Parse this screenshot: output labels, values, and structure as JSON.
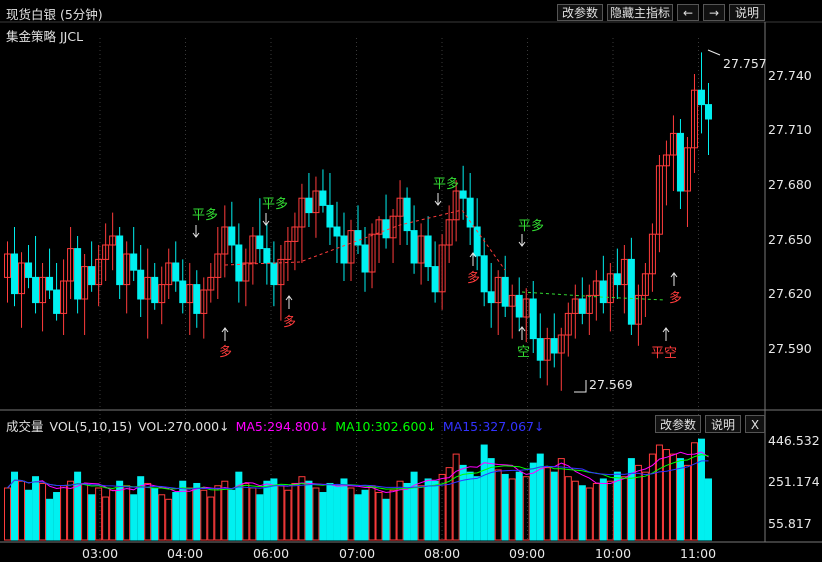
{
  "header": {
    "title": "现货白银 (5分钟)",
    "strategy": "集金策略 JJCL",
    "buttons": {
      "params": "改参数",
      "hide_indicator": "隐藏主指标",
      "left_arrow": "←",
      "right_arrow": "→",
      "help": "说明"
    }
  },
  "colors": {
    "up": "#ff3c3c",
    "down": "#00f0f0",
    "buy": "#ff3c3c",
    "close": "#33dd33",
    "ma5": "#ff00ff",
    "ma10": "#00ff00",
    "ma15": "#3333ff"
  },
  "price_axis": {
    "labels": [
      "27.740",
      "27.710",
      "27.680",
      "27.650",
      "27.620",
      "27.590"
    ],
    "high_label": "27.757",
    "low_label": "27.569"
  },
  "signals": [
    {
      "text": "平多",
      "kind": "close"
    },
    {
      "text": "平多",
      "kind": "close"
    },
    {
      "text": "平多",
      "kind": "close"
    },
    {
      "text": "平多",
      "kind": "close"
    },
    {
      "text": "多",
      "kind": "buy"
    },
    {
      "text": "多",
      "kind": "buy"
    },
    {
      "text": "多",
      "kind": "buy"
    },
    {
      "text": "空",
      "kind": "close"
    },
    {
      "text": "多",
      "kind": "buy"
    },
    {
      "text": "平空",
      "kind": "buy"
    }
  ],
  "volume": {
    "title": "成交量",
    "params": "VOL(5,10,15)",
    "vol": "VOL:270.000↓",
    "ma5": "MA5:294.800↓",
    "ma10": "MA10:302.600↓",
    "ma15": "MA15:327.067↓",
    "axis_labels": [
      "446.532",
      "251.174",
      "55.817"
    ],
    "buttons": {
      "params": "改参数",
      "help": "说明",
      "close": "X"
    }
  },
  "time_axis": [
    "03:00",
    "04:00",
    "06:00",
    "07:00",
    "08:00",
    "09:00",
    "10:00",
    "11:00"
  ],
  "chart_data": {
    "type": "candlestick",
    "ylim": [
      27.565,
      27.765
    ],
    "series_note": "approximate 5-minute OHLC + volume readings",
    "candles": [
      [
        27.632,
        27.652,
        27.618,
        27.645,
        230
      ],
      [
        27.645,
        27.66,
        27.616,
        27.623,
        300
      ],
      [
        27.623,
        27.646,
        27.604,
        27.64,
        260
      ],
      [
        27.64,
        27.65,
        27.626,
        27.632,
        220
      ],
      [
        27.632,
        27.655,
        27.612,
        27.618,
        280
      ],
      [
        27.618,
        27.64,
        27.602,
        27.632,
        250
      ],
      [
        27.632,
        27.648,
        27.62,
        27.625,
        180
      ],
      [
        27.625,
        27.64,
        27.608,
        27.612,
        210
      ],
      [
        27.612,
        27.642,
        27.6,
        27.63,
        240
      ],
      [
        27.63,
        27.66,
        27.62,
        27.648,
        260
      ],
      [
        27.648,
        27.655,
        27.612,
        27.62,
        300
      ],
      [
        27.62,
        27.645,
        27.6,
        27.638,
        250
      ],
      [
        27.638,
        27.652,
        27.624,
        27.628,
        200
      ],
      [
        27.628,
        27.65,
        27.616,
        27.642,
        230
      ],
      [
        27.642,
        27.662,
        27.63,
        27.65,
        190
      ],
      [
        27.65,
        27.668,
        27.636,
        27.655,
        220
      ],
      [
        27.655,
        27.66,
        27.62,
        27.628,
        260
      ],
      [
        27.628,
        27.652,
        27.612,
        27.645,
        240
      ],
      [
        27.645,
        27.66,
        27.63,
        27.636,
        200
      ],
      [
        27.636,
        27.65,
        27.61,
        27.62,
        280
      ],
      [
        27.62,
        27.648,
        27.598,
        27.632,
        250
      ],
      [
        27.632,
        27.64,
        27.614,
        27.618,
        230
      ],
      [
        27.618,
        27.638,
        27.606,
        27.628,
        200
      ],
      [
        27.628,
        27.648,
        27.62,
        27.64,
        180
      ],
      [
        27.64,
        27.652,
        27.624,
        27.63,
        210
      ],
      [
        27.63,
        27.642,
        27.612,
        27.618,
        260
      ],
      [
        27.618,
        27.64,
        27.6,
        27.628,
        230
      ],
      [
        27.628,
        27.636,
        27.604,
        27.612,
        250
      ],
      [
        27.612,
        27.632,
        27.598,
        27.625,
        220
      ],
      [
        27.625,
        27.64,
        27.618,
        27.632,
        190
      ],
      [
        27.632,
        27.66,
        27.62,
        27.645,
        240
      ],
      [
        27.645,
        27.672,
        27.632,
        27.66,
        260
      ],
      [
        27.66,
        27.674,
        27.64,
        27.65,
        220
      ],
      [
        27.65,
        27.662,
        27.618,
        27.63,
        300
      ],
      [
        27.63,
        27.648,
        27.616,
        27.64,
        250
      ],
      [
        27.64,
        27.66,
        27.628,
        27.655,
        230
      ],
      [
        27.655,
        27.676,
        27.64,
        27.648,
        200
      ],
      [
        27.648,
        27.662,
        27.628,
        27.64,
        260
      ],
      [
        27.64,
        27.652,
        27.616,
        27.628,
        270
      ],
      [
        27.628,
        27.65,
        27.608,
        27.642,
        240
      ],
      [
        27.642,
        27.66,
        27.63,
        27.652,
        220
      ],
      [
        27.652,
        27.668,
        27.636,
        27.66,
        250
      ],
      [
        27.66,
        27.684,
        27.64,
        27.676,
        280
      ],
      [
        27.676,
        27.69,
        27.66,
        27.668,
        260
      ],
      [
        27.668,
        27.688,
        27.654,
        27.68,
        230
      ],
      [
        27.68,
        27.692,
        27.668,
        27.672,
        210
      ],
      [
        27.672,
        27.69,
        27.65,
        27.66,
        250
      ],
      [
        27.66,
        27.674,
        27.64,
        27.655,
        240
      ],
      [
        27.655,
        27.668,
        27.63,
        27.64,
        270
      ],
      [
        27.64,
        27.664,
        27.63,
        27.658,
        230
      ],
      [
        27.658,
        27.672,
        27.645,
        27.65,
        200
      ],
      [
        27.65,
        27.66,
        27.624,
        27.635,
        220
      ],
      [
        27.635,
        27.662,
        27.626,
        27.656,
        240
      ],
      [
        27.656,
        27.666,
        27.64,
        27.664,
        210
      ],
      [
        27.664,
        27.678,
        27.648,
        27.654,
        180
      ],
      [
        27.654,
        27.67,
        27.64,
        27.666,
        220
      ],
      [
        27.666,
        27.686,
        27.65,
        27.676,
        260
      ],
      [
        27.676,
        27.682,
        27.65,
        27.658,
        250
      ],
      [
        27.658,
        27.672,
        27.634,
        27.64,
        300
      ],
      [
        27.64,
        27.662,
        27.628,
        27.655,
        240
      ],
      [
        27.655,
        27.666,
        27.63,
        27.638,
        270
      ],
      [
        27.638,
        27.652,
        27.618,
        27.624,
        260
      ],
      [
        27.624,
        27.656,
        27.614,
        27.65,
        290
      ],
      [
        27.65,
        27.672,
        27.64,
        27.664,
        320
      ],
      [
        27.664,
        27.686,
        27.652,
        27.68,
        380
      ],
      [
        27.68,
        27.694,
        27.664,
        27.676,
        330
      ],
      [
        27.676,
        27.69,
        27.65,
        27.66,
        300
      ],
      [
        27.66,
        27.676,
        27.636,
        27.644,
        280
      ],
      [
        27.644,
        27.654,
        27.616,
        27.624,
        420
      ],
      [
        27.624,
        27.64,
        27.604,
        27.618,
        360
      ],
      [
        27.618,
        27.636,
        27.6,
        27.632,
        310
      ],
      [
        27.632,
        27.644,
        27.61,
        27.616,
        290
      ],
      [
        27.616,
        27.628,
        27.598,
        27.622,
        270
      ],
      [
        27.622,
        27.632,
        27.602,
        27.61,
        300
      ],
      [
        27.61,
        27.626,
        27.596,
        27.62,
        280
      ],
      [
        27.62,
        27.63,
        27.59,
        27.598,
        340
      ],
      [
        27.598,
        27.612,
        27.576,
        27.586,
        380
      ],
      [
        27.586,
        27.604,
        27.572,
        27.598,
        320
      ],
      [
        27.598,
        27.612,
        27.582,
        27.59,
        300
      ],
      [
        27.59,
        27.604,
        27.569,
        27.6,
        360
      ],
      [
        27.6,
        27.618,
        27.588,
        27.612,
        280
      ],
      [
        27.612,
        27.628,
        27.598,
        27.62,
        260
      ],
      [
        27.62,
        27.632,
        27.606,
        27.612,
        240
      ],
      [
        27.612,
        27.628,
        27.6,
        27.622,
        230
      ],
      [
        27.622,
        27.636,
        27.608,
        27.63,
        250
      ],
      [
        27.63,
        27.644,
        27.612,
        27.618,
        270
      ],
      [
        27.618,
        27.64,
        27.602,
        27.634,
        260
      ],
      [
        27.634,
        27.648,
        27.62,
        27.628,
        300
      ],
      [
        27.628,
        27.65,
        27.612,
        27.642,
        280
      ],
      [
        27.642,
        27.654,
        27.6,
        27.606,
        360
      ],
      [
        27.606,
        27.628,
        27.594,
        27.622,
        330
      ],
      [
        27.622,
        27.64,
        27.61,
        27.634,
        300
      ],
      [
        27.634,
        27.662,
        27.624,
        27.656,
        380
      ],
      [
        27.656,
        27.7,
        27.646,
        27.694,
        420
      ],
      [
        27.694,
        27.708,
        27.672,
        27.7,
        400
      ],
      [
        27.7,
        27.722,
        27.68,
        27.712,
        380
      ],
      [
        27.712,
        27.72,
        27.67,
        27.68,
        360
      ],
      [
        27.68,
        27.71,
        27.66,
        27.704,
        330
      ],
      [
        27.704,
        27.745,
        27.69,
        27.736,
        430
      ],
      [
        27.736,
        27.757,
        27.712,
        27.728,
        446
      ],
      [
        27.728,
        27.74,
        27.7,
        27.72,
        270
      ]
    ]
  }
}
